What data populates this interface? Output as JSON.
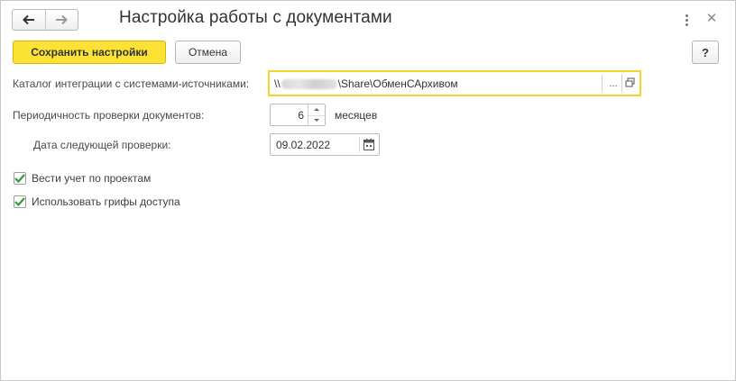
{
  "window": {
    "title": "Настройка работы с документами"
  },
  "toolbar": {
    "save_label": "Сохранить настройки",
    "cancel_label": "Отмена",
    "help_label": "?"
  },
  "form": {
    "integration_catalog": {
      "label": "Каталог интеграции с системами-источниками:",
      "value_prefix": "\\\\",
      "value_suffix": "\\Share\\ОбменСАрхивом",
      "select_button": "..."
    },
    "check_period": {
      "label": "Периодичность проверки документов:",
      "value": "6",
      "unit": "месяцев"
    },
    "next_check_date": {
      "label": "Дата следующей проверки:",
      "value": "09.02.2022"
    },
    "checkboxes": [
      {
        "label": "Вести учет по проектам",
        "checked": true
      },
      {
        "label": "Использовать грифы доступа",
        "checked": true
      }
    ]
  },
  "colors": {
    "accent": "#fbe234",
    "focus_border": "#f2d52a",
    "check": "#2e9b3a"
  }
}
